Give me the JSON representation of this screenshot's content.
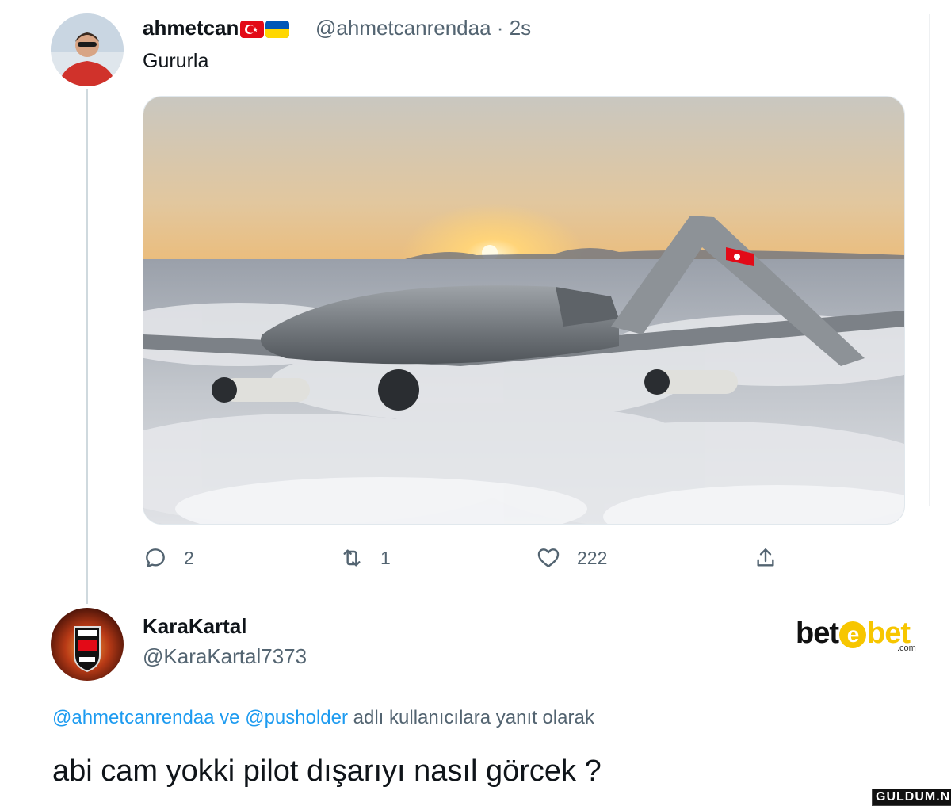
{
  "tweet": {
    "display_name": "ahmetcan",
    "flags": [
      "turkey-flag",
      "ukraine-flag"
    ],
    "handle": "@ahmetcanrendaa",
    "separator": "·",
    "time": "2s",
    "text": "Gururla",
    "media_description_icon": "drone-image",
    "actions": {
      "reply_count": "2",
      "retweet_count": "1",
      "like_count": "222"
    }
  },
  "reply": {
    "display_name": "KaraKartal",
    "handle": "@KaraKartal7373",
    "replying_to_mention_1": "@ahmetcanrendaa",
    "replying_to_joiner": "ve",
    "replying_to_mention_2": "@pusholder",
    "replying_to_suffix": "adlı kullanıcılara yanıt olarak",
    "text": "abi cam yokki pilot dışarıyı nasıl görcek ?"
  },
  "brand": {
    "part1": "bet",
    "part2": "bet",
    "e_glyph": "e",
    "suffix": ".com"
  },
  "watermark": "GULDUM.NET",
  "colors": {
    "link": "#1d9bf0",
    "muted": "#536471",
    "brand_yellow": "#f7c600"
  }
}
